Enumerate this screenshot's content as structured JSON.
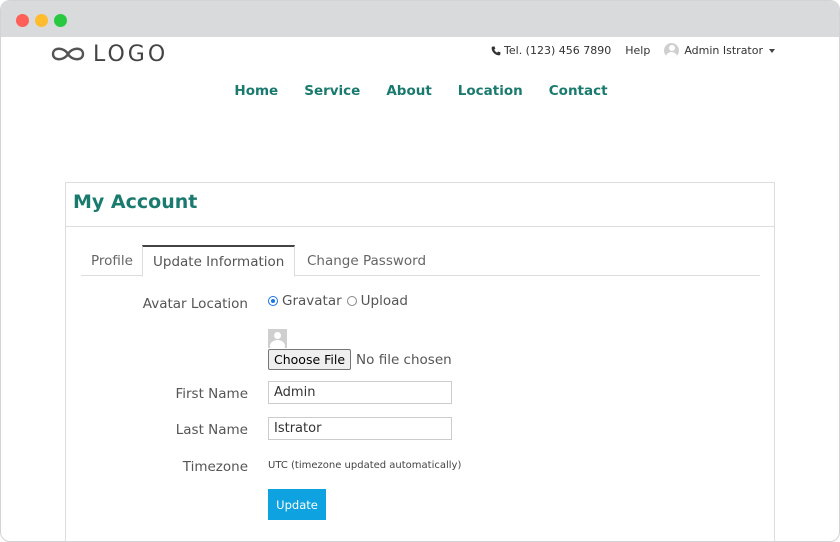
{
  "window": {
    "controls": [
      {
        "name": "close",
        "color": "#ff5f57"
      },
      {
        "name": "minimize",
        "color": "#febc2e"
      },
      {
        "name": "maximize",
        "color": "#28c840"
      }
    ]
  },
  "header": {
    "logo_text": "LOGO",
    "phone": "Tel. (123) 456 7890",
    "help": "Help",
    "user_name": "Admin Istrator"
  },
  "nav": [
    "Home",
    "Service",
    "About",
    "Location",
    "Contact"
  ],
  "account": {
    "title": "My Account",
    "tabs": [
      "Profile",
      "Update Information",
      "Change Password"
    ],
    "active_tab": "Update Information",
    "avatar_location_label": "Avatar Location",
    "avatar_options": [
      "Gravatar",
      "Upload"
    ],
    "avatar_selected": "Gravatar",
    "file_button": "Choose File",
    "file_status": "No file chosen",
    "first_name_label": "First Name",
    "first_name_value": "Admin",
    "last_name_label": "Last Name",
    "last_name_value": "Istrator",
    "timezone_label": "Timezone",
    "timezone_note": "UTC (timezone updated automatically)",
    "update_button": "Update"
  },
  "colors": {
    "accent": "#1b7a6e",
    "button": "#0ea2e0",
    "radio_selected": "#1a73e8"
  }
}
